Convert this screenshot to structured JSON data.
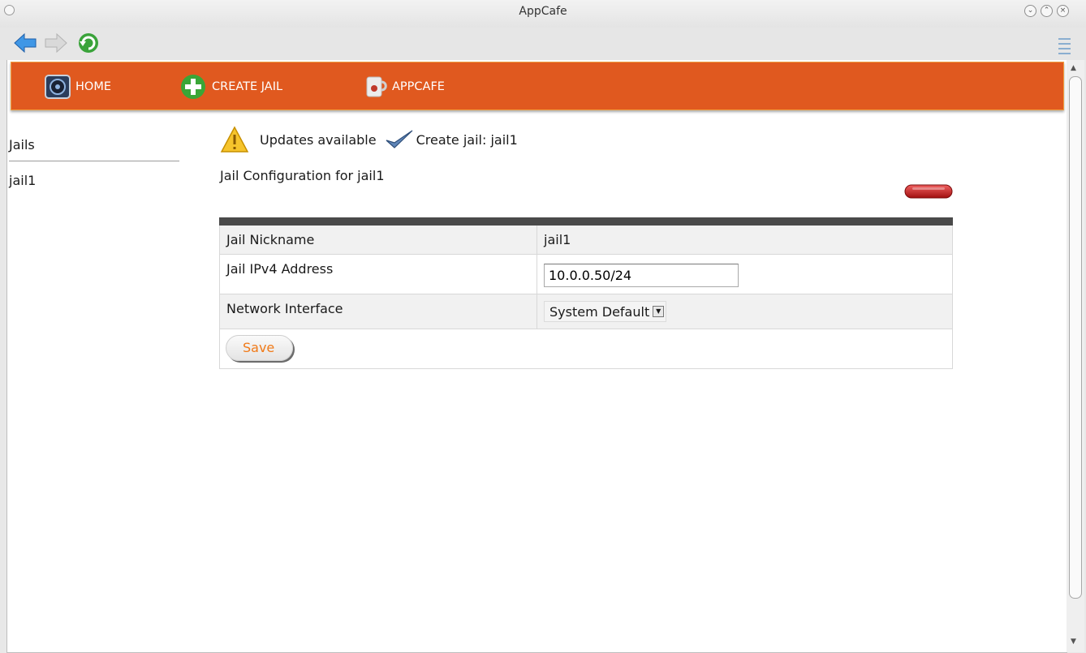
{
  "window": {
    "title": "AppCafe"
  },
  "toolbar": {
    "back": "back-icon",
    "forward": "forward-icon",
    "refresh": "refresh-icon",
    "menu": "menu-icon"
  },
  "nav": {
    "items": [
      {
        "label": "HOME",
        "icon": "home-icon"
      },
      {
        "label": "CREATE JAIL",
        "icon": "plus-icon"
      },
      {
        "label": "APPCAFE",
        "icon": "appcafe-icon"
      }
    ],
    "bg_color": "#e0591f"
  },
  "sidebar": {
    "heading": "Jails",
    "items": [
      "jail1"
    ]
  },
  "status": {
    "updates": "Updates available",
    "create": "Create jail: jail1"
  },
  "config": {
    "title": "Jail Configuration for jail1",
    "rows": {
      "nickname": {
        "label": "Jail Nickname",
        "value": "jail1"
      },
      "ipv4": {
        "label": "Jail IPv4 Address",
        "value": "10.0.0.50/24"
      },
      "interface": {
        "label": "Network Interface",
        "value": "System Default"
      }
    },
    "save_label": "Save"
  }
}
